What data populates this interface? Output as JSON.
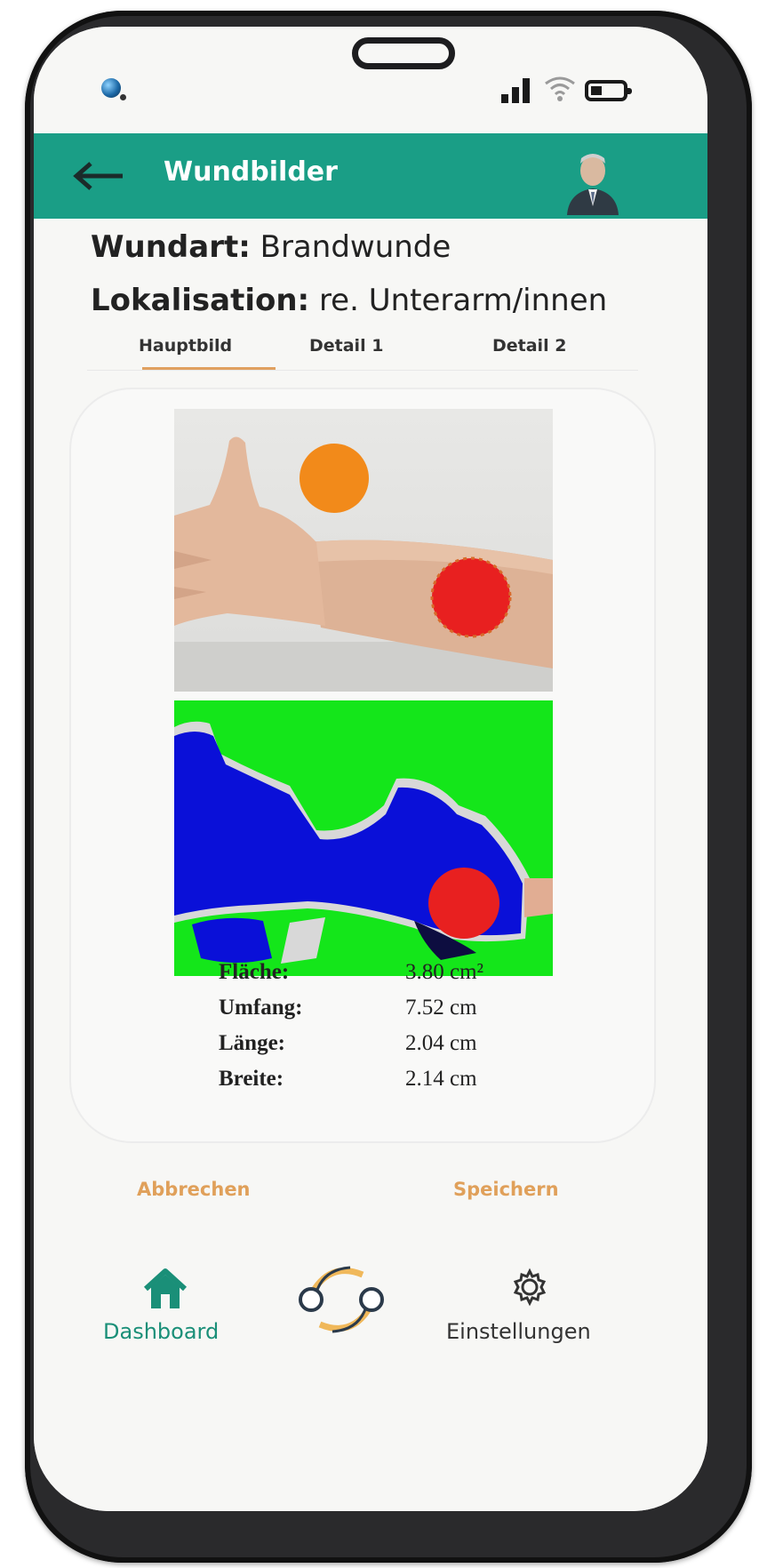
{
  "header": {
    "title": "Wundbilder"
  },
  "info": {
    "wound_type_label": "Wundart:",
    "wound_type_value": "Brandwunde",
    "location_label": "Lokalisation:",
    "location_value": "re. Unterarm/innen"
  },
  "tabs": [
    {
      "label": "Hauptbild",
      "active": true
    },
    {
      "label": "Detail 1",
      "active": false
    },
    {
      "label": "Detail 2",
      "active": false
    }
  ],
  "measurements": [
    {
      "label": "Fläche:",
      "value": "3.80 cm²"
    },
    {
      "label": "Umfang:",
      "value": "7.52 cm"
    },
    {
      "label": "Länge:",
      "value": "2.04 cm"
    },
    {
      "label": "Breite:",
      "value": "2.14 cm"
    }
  ],
  "actions": {
    "cancel": "Abbrechen",
    "save": "Speichern"
  },
  "nav": {
    "dashboard": "Dashboard",
    "settings": "Einstellungen"
  },
  "colors": {
    "header": "#1a9e86",
    "accent": "#e0a05a",
    "nav_active": "#1a8f78",
    "segmentation_background": "#14e61a",
    "segmentation_tissue": "#0a10d8",
    "wound_marker": "#e82020",
    "reference_marker": "#f28a1a"
  },
  "icons": [
    "globe-icon",
    "signal-icon",
    "wifi-icon",
    "battery-icon",
    "back-arrow-icon",
    "home-icon",
    "sync-logo-icon",
    "gear-icon"
  ]
}
